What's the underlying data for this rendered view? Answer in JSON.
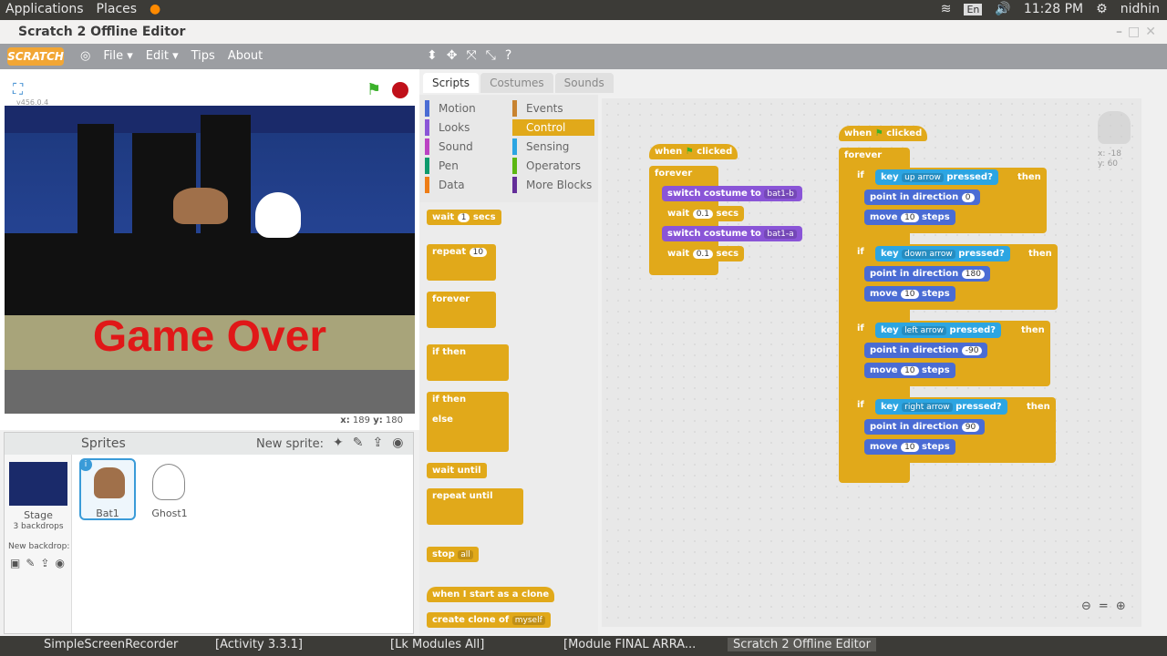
{
  "top_panel": {
    "applications": "Applications",
    "places": "Places",
    "keyboard": "En",
    "time": "11:28 PM",
    "user": "nidhin"
  },
  "window": {
    "title": "Scratch 2 Offline Editor"
  },
  "menu": {
    "logo": "SCRATCH",
    "file": "File ▾",
    "edit": "Edit ▾",
    "tips": "Tips",
    "about": "About"
  },
  "stage": {
    "version": "v456.0.4",
    "game_over": "Game Over",
    "x_label": "x:",
    "x_value": "189",
    "y_label": "y:",
    "y_value": "180"
  },
  "sprites": {
    "header": "Sprites",
    "new_sprite": "New sprite:",
    "stage_label": "Stage",
    "backdrops": "3 backdrops",
    "new_backdrop": "New backdrop:",
    "items": [
      "Bat1",
      "Ghost1"
    ]
  },
  "tabs": [
    "Scripts",
    "Costumes",
    "Sounds"
  ],
  "categories": [
    "Motion",
    "Events",
    "Looks",
    "Control",
    "Sound",
    "Sensing",
    "Pen",
    "Operators",
    "Data",
    "More Blocks"
  ],
  "palette": {
    "wait": "wait",
    "wait_val": "1",
    "secs": "secs",
    "repeat": "repeat",
    "repeat_val": "10",
    "forever": "forever",
    "if": "if",
    "then": "then",
    "else": "else",
    "wait_until": "wait until",
    "repeat_until": "repeat until",
    "stop": "stop",
    "stop_val": "all",
    "when_clone": "when I start as a clone",
    "create_clone": "create clone of",
    "create_clone_val": "myself"
  },
  "script1": {
    "when": "when",
    "clicked": "clicked",
    "forever": "forever",
    "switch": "switch costume to",
    "c1": "bat1-b",
    "wait": "wait",
    "w1": "0.1",
    "secs": "secs",
    "c2": "bat1-a"
  },
  "script2": {
    "when": "when",
    "clicked": "clicked",
    "forever": "forever",
    "key": "key",
    "pressed": "pressed?",
    "then": "then",
    "if": "if",
    "point": "point in direction",
    "move": "move",
    "steps": "steps",
    "k1": "up arrow",
    "d1": "0",
    "k2": "down arrow",
    "d2": "180",
    "k3": "left arrow",
    "d3": "-90",
    "k4": "right arrow",
    "d4": "90",
    "n": "10"
  },
  "sprite_info": {
    "x": "x: -18",
    "y": "y: 60"
  },
  "taskbar": [
    "SimpleScreenRecorder",
    "[Activity 3.3.1]",
    "[Lk Modules All]",
    "[Module FINAL ARRA...",
    "Scratch 2 Offline Editor"
  ]
}
